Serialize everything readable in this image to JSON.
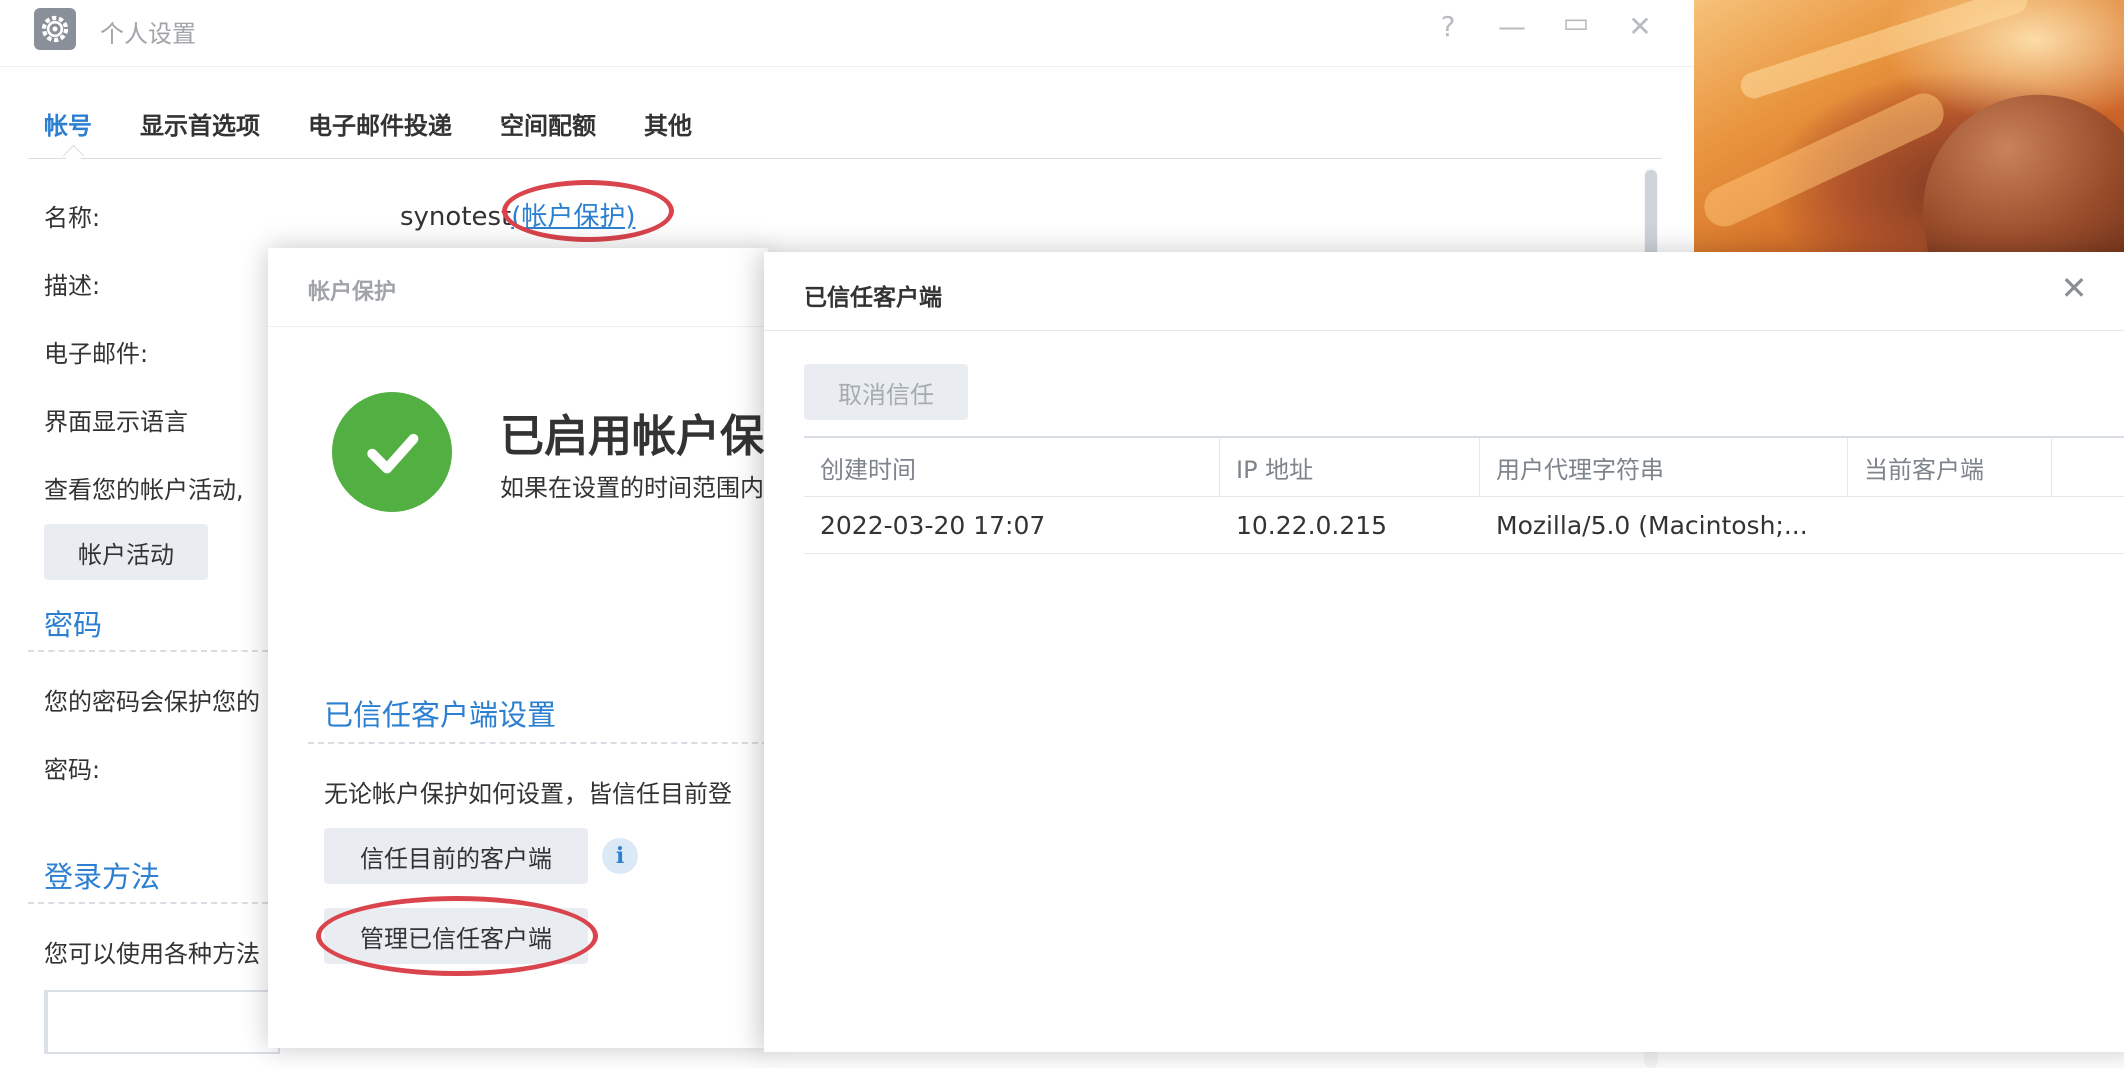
{
  "window": {
    "title": "个人设置",
    "help": "?",
    "minimize": "—",
    "maximize": "▭",
    "close": "✕"
  },
  "tabs": [
    "帐号",
    "显示首选项",
    "电子邮件投递",
    "空间配额",
    "其他"
  ],
  "account": {
    "name_label": "名称:",
    "name_value": "synotest",
    "protection_link": "(帐户保护)",
    "desc_label": "描述:",
    "email_label": "电子邮件:",
    "language_label": "界面显示语言",
    "activity_text": "查看您的帐户活动,",
    "activity_button": "帐户活动"
  },
  "password": {
    "title": "密码",
    "desc": "您的密码会保护您的",
    "label": "密码:"
  },
  "login": {
    "title": "登录方法",
    "desc": "您可以使用各种方法"
  },
  "protection_dialog": {
    "title": "帐户保护",
    "heading": "已启用帐户保",
    "subtext": "如果在设置的时间范围内",
    "trusted_section_title": "已信任客户端设置",
    "trusted_desc": "无论帐户保护如何设置，皆信任目前登",
    "trust_button": "信任目前的客户端",
    "info_icon": "i",
    "manage_button": "管理已信任客户端"
  },
  "trusted_dialog": {
    "title": "已信任客户端",
    "close": "✕",
    "revoke_button": "取消信任",
    "columns": [
      "创建时间",
      "IP 地址",
      "用户代理字符串",
      "当前客户端"
    ],
    "rows": [
      {
        "created": "2022-03-20 17:07",
        "ip": "10.22.0.215",
        "user_agent": "Mozilla/5.0 (Macintosh;...",
        "current": ""
      }
    ]
  }
}
